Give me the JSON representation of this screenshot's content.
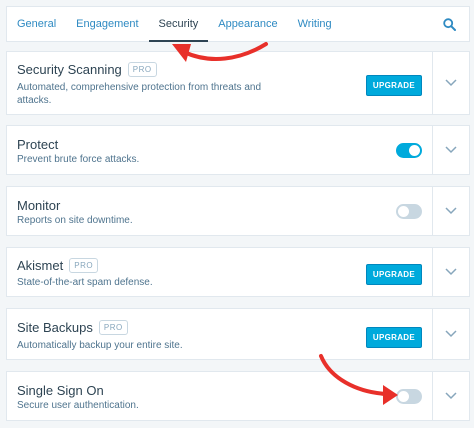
{
  "tabs": [
    {
      "label": "General"
    },
    {
      "label": "Engagement"
    },
    {
      "label": "Security"
    },
    {
      "label": "Appearance"
    },
    {
      "label": "Writing"
    }
  ],
  "active_tab": "Security",
  "cards": [
    {
      "title": "Security Scanning",
      "pro": "PRO",
      "desc": "Automated, comprehensive protection from threats and attacks.",
      "action": "UPGRADE"
    },
    {
      "title": "Protect",
      "desc": "Prevent brute force attacks.",
      "toggle": "on"
    },
    {
      "title": "Monitor",
      "desc": "Reports on site downtime.",
      "toggle": "off"
    },
    {
      "title": "Akismet",
      "pro": "PRO",
      "desc": "State-of-the-art spam defense.",
      "action": "UPGRADE"
    },
    {
      "title": "Site Backups",
      "pro": "PRO",
      "desc": "Automatically backup your entire site.",
      "action": "UPGRADE"
    },
    {
      "title": "Single Sign On",
      "desc": "Secure user authentication.",
      "toggle": "off"
    }
  ],
  "colors": {
    "accent": "#00aadc",
    "link": "#2e8ac2",
    "arrow": "#e8302a"
  },
  "icons": {
    "search": "search-icon",
    "chevron": "chevron-down-icon"
  }
}
